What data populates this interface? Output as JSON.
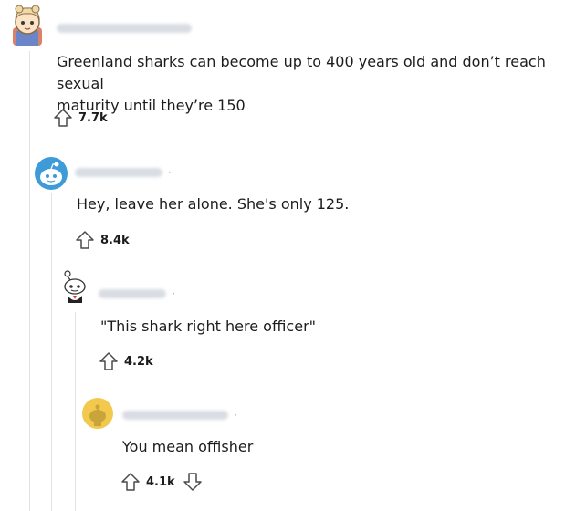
{
  "comments": [
    {
      "id": "c1",
      "text": "Greenland sharks can become up to 400 years old and don’t reach sexual\nmaturity until they’re 150",
      "votes": "7.7k",
      "avatar_icon": "cartoon-character-avatar-icon"
    },
    {
      "id": "c2",
      "text": "Hey, leave her alone. She's only 125.",
      "votes": "8.4k",
      "avatar_icon": "blue-snoo-avatar-icon"
    },
    {
      "id": "c3",
      "text": "\"This shark right here officer\"",
      "votes": "4.2k",
      "avatar_icon": "snoo-mascot-avatar-icon"
    },
    {
      "id": "c4",
      "text": "You mean offisher",
      "votes": "4.1k",
      "avatar_icon": "yellow-snoo-avatar-icon"
    }
  ],
  "separator": "·",
  "colors": {
    "text": "#1c1c1c",
    "muted": "#7c7c7c",
    "thread_line": "#e3e3e3",
    "blue_avatar": "#3d9bd8",
    "yellow_avatar": "#f2c94c"
  }
}
